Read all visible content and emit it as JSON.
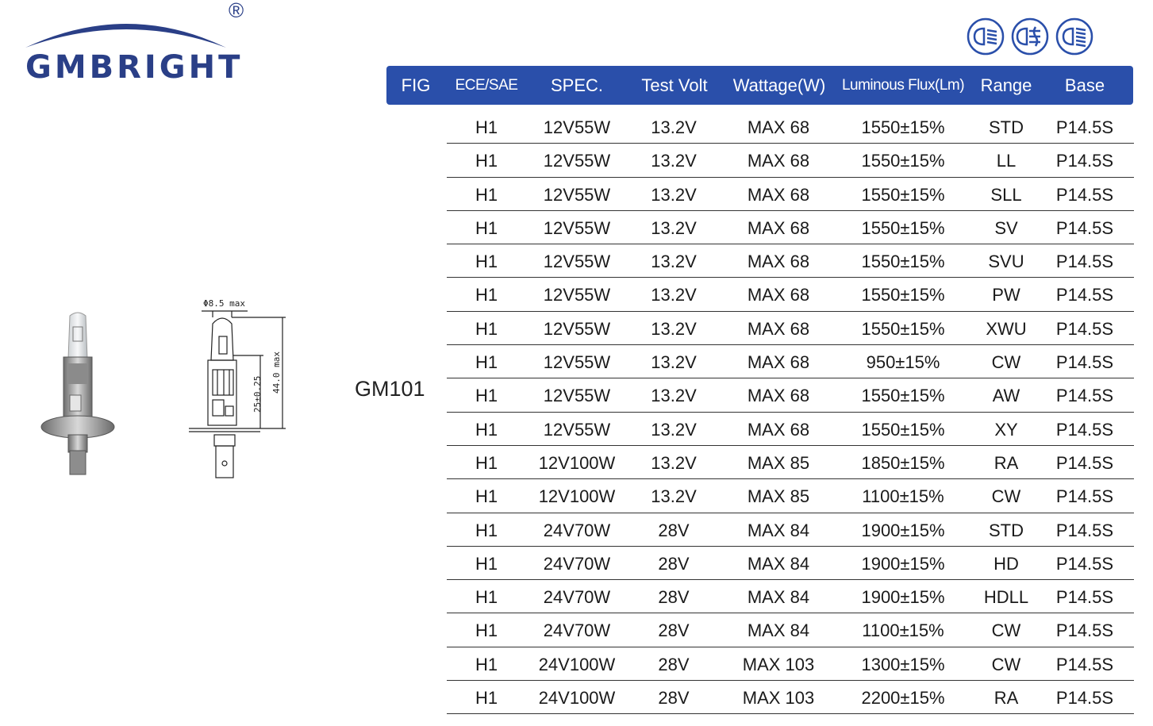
{
  "brand": {
    "name": "GMBRIGHT",
    "registered": "®",
    "color": "#2a3f87"
  },
  "header_color": "#2a4faa",
  "icons": [
    "low-beam-icon",
    "fog-light-icon",
    "high-beam-icon"
  ],
  "model": "GM101",
  "drawing_labels": {
    "diameter": "Φ8.5 max",
    "height_total": "44.0 max",
    "height_focus": "25±0.25"
  },
  "columns": [
    "FIG",
    "ECE/SAE",
    "SPEC.",
    "Test Volt",
    "Wattage(W)",
    "Luminous Flux(Lm)",
    "Range",
    "Base"
  ],
  "rows": [
    [
      "H1",
      "12V55W",
      "13.2V",
      "MAX 68",
      "1550±15%",
      "STD",
      "P14.5S"
    ],
    [
      "H1",
      "12V55W",
      "13.2V",
      "MAX 68",
      "1550±15%",
      "LL",
      "P14.5S"
    ],
    [
      "H1",
      "12V55W",
      "13.2V",
      "MAX 68",
      "1550±15%",
      "SLL",
      "P14.5S"
    ],
    [
      "H1",
      "12V55W",
      "13.2V",
      "MAX 68",
      "1550±15%",
      "SV",
      "P14.5S"
    ],
    [
      "H1",
      "12V55W",
      "13.2V",
      "MAX 68",
      "1550±15%",
      "SVU",
      "P14.5S"
    ],
    [
      "H1",
      "12V55W",
      "13.2V",
      "MAX 68",
      "1550±15%",
      "PW",
      "P14.5S"
    ],
    [
      "H1",
      "12V55W",
      "13.2V",
      "MAX 68",
      "1550±15%",
      "XWU",
      "P14.5S"
    ],
    [
      "H1",
      "12V55W",
      "13.2V",
      "MAX 68",
      "950±15%",
      "CW",
      "P14.5S"
    ],
    [
      "H1",
      "12V55W",
      "13.2V",
      "MAX 68",
      "1550±15%",
      "AW",
      "P14.5S"
    ],
    [
      "H1",
      "12V55W",
      "13.2V",
      "MAX 68",
      "1550±15%",
      "XY",
      "P14.5S"
    ],
    [
      "H1",
      "12V100W",
      "13.2V",
      "MAX 85",
      "1850±15%",
      "RA",
      "P14.5S"
    ],
    [
      "H1",
      "12V100W",
      "13.2V",
      "MAX 85",
      "1100±15%",
      "CW",
      "P14.5S"
    ],
    [
      "H1",
      "24V70W",
      "28V",
      "MAX 84",
      "1900±15%",
      "STD",
      "P14.5S"
    ],
    [
      "H1",
      "24V70W",
      "28V",
      "MAX 84",
      "1900±15%",
      "HD",
      "P14.5S"
    ],
    [
      "H1",
      "24V70W",
      "28V",
      "MAX 84",
      "1900±15%",
      "HDLL",
      "P14.5S"
    ],
    [
      "H1",
      "24V70W",
      "28V",
      "MAX 84",
      "1100±15%",
      "CW",
      "P14.5S"
    ],
    [
      "H1",
      "24V100W",
      "28V",
      "MAX 103",
      "1300±15%",
      "CW",
      "P14.5S"
    ],
    [
      "H1",
      "24V100W",
      "28V",
      "MAX 103",
      "2200±15%",
      "RA",
      "P14.5S"
    ]
  ]
}
